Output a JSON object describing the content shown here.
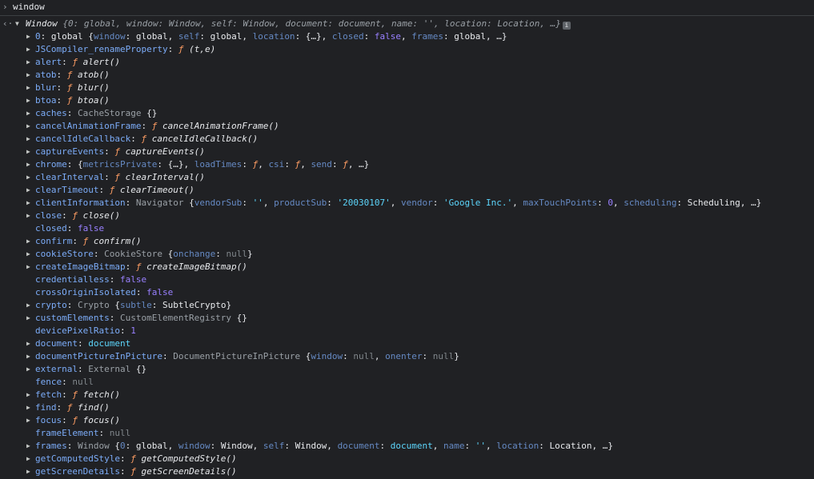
{
  "input": {
    "prompt": "›",
    "command": "window"
  },
  "result_marker": "‹·",
  "root": {
    "label": "Window",
    "preview": "{0: global, window: Window, self: Window, document: document, name: '', location: Location, …}",
    "info_glyph": "i"
  },
  "props": [
    {
      "key": "0",
      "expandable": true,
      "parts": [
        [
          "obj",
          "global "
        ],
        [
          "p",
          "{"
        ],
        [
          "kd",
          "window"
        ],
        [
          "p",
          ": global, "
        ],
        [
          "kd",
          "self"
        ],
        [
          "p",
          ": global, "
        ],
        [
          "kd",
          "location"
        ],
        [
          "p",
          ": {…}, "
        ],
        [
          "kd",
          "closed"
        ],
        [
          "p",
          ": "
        ],
        [
          "b",
          "false"
        ],
        [
          "p",
          ", "
        ],
        [
          "kd",
          "frames"
        ],
        [
          "p",
          ": global, …}"
        ]
      ]
    },
    {
      "key": "JSCompiler_renameProperty",
      "expandable": true,
      "parts": [
        [
          "fn",
          "ƒ "
        ],
        [
          "fname",
          "(t,e)"
        ]
      ]
    },
    {
      "key": "alert",
      "expandable": true,
      "parts": [
        [
          "fn",
          "ƒ "
        ],
        [
          "fname",
          "alert()"
        ]
      ]
    },
    {
      "key": "atob",
      "expandable": true,
      "parts": [
        [
          "fn",
          "ƒ "
        ],
        [
          "fname",
          "atob()"
        ]
      ]
    },
    {
      "key": "blur",
      "expandable": true,
      "parts": [
        [
          "fn",
          "ƒ "
        ],
        [
          "fname",
          "blur()"
        ]
      ]
    },
    {
      "key": "btoa",
      "expandable": true,
      "parts": [
        [
          "fn",
          "ƒ "
        ],
        [
          "fname",
          "btoa()"
        ]
      ]
    },
    {
      "key": "caches",
      "expandable": true,
      "parts": [
        [
          "cls",
          "CacheStorage "
        ],
        [
          "p",
          "{}"
        ]
      ]
    },
    {
      "key": "cancelAnimationFrame",
      "expandable": true,
      "parts": [
        [
          "fn",
          "ƒ "
        ],
        [
          "fname",
          "cancelAnimationFrame()"
        ]
      ]
    },
    {
      "key": "cancelIdleCallback",
      "expandable": true,
      "parts": [
        [
          "fn",
          "ƒ "
        ],
        [
          "fname",
          "cancelIdleCallback()"
        ]
      ]
    },
    {
      "key": "captureEvents",
      "expandable": true,
      "parts": [
        [
          "fn",
          "ƒ "
        ],
        [
          "fname",
          "captureEvents()"
        ]
      ]
    },
    {
      "key": "chrome",
      "expandable": true,
      "parts": [
        [
          "p",
          "{"
        ],
        [
          "kd",
          "metricsPrivate"
        ],
        [
          "p",
          ": {…}, "
        ],
        [
          "kd",
          "loadTimes"
        ],
        [
          "p",
          ": "
        ],
        [
          "fn",
          "ƒ"
        ],
        [
          "p",
          ", "
        ],
        [
          "kd",
          "csi"
        ],
        [
          "p",
          ": "
        ],
        [
          "fn",
          "ƒ"
        ],
        [
          "p",
          ", "
        ],
        [
          "kd",
          "send"
        ],
        [
          "p",
          ": "
        ],
        [
          "fn",
          "ƒ"
        ],
        [
          "p",
          ", …}"
        ]
      ]
    },
    {
      "key": "clearInterval",
      "expandable": true,
      "parts": [
        [
          "fn",
          "ƒ "
        ],
        [
          "fname",
          "clearInterval()"
        ]
      ]
    },
    {
      "key": "clearTimeout",
      "expandable": true,
      "parts": [
        [
          "fn",
          "ƒ "
        ],
        [
          "fname",
          "clearTimeout()"
        ]
      ]
    },
    {
      "key": "clientInformation",
      "expandable": true,
      "parts": [
        [
          "cls",
          "Navigator "
        ],
        [
          "p",
          "{"
        ],
        [
          "kd",
          "vendorSub"
        ],
        [
          "p",
          ": "
        ],
        [
          "s",
          "''"
        ],
        [
          "p",
          ", "
        ],
        [
          "kd",
          "productSub"
        ],
        [
          "p",
          ": "
        ],
        [
          "s",
          "'20030107'"
        ],
        [
          "p",
          ", "
        ],
        [
          "kd",
          "vendor"
        ],
        [
          "p",
          ": "
        ],
        [
          "s",
          "'Google Inc.'"
        ],
        [
          "p",
          ", "
        ],
        [
          "kd",
          "maxTouchPoints"
        ],
        [
          "p",
          ": "
        ],
        [
          "b",
          "0"
        ],
        [
          "p",
          ", "
        ],
        [
          "kd",
          "scheduling"
        ],
        [
          "p",
          ": Scheduling, …}"
        ]
      ]
    },
    {
      "key": "close",
      "expandable": true,
      "parts": [
        [
          "fn",
          "ƒ "
        ],
        [
          "fname",
          "close()"
        ]
      ]
    },
    {
      "key": "closed",
      "expandable": false,
      "parts": [
        [
          "b",
          "false"
        ]
      ]
    },
    {
      "key": "confirm",
      "expandable": true,
      "parts": [
        [
          "fn",
          "ƒ "
        ],
        [
          "fname",
          "confirm()"
        ]
      ]
    },
    {
      "key": "cookieStore",
      "expandable": true,
      "parts": [
        [
          "cls",
          "CookieStore "
        ],
        [
          "p",
          "{"
        ],
        [
          "kd",
          "onchange"
        ],
        [
          "p",
          ": "
        ],
        [
          "n",
          "null"
        ],
        [
          "p",
          "}"
        ]
      ]
    },
    {
      "key": "createImageBitmap",
      "expandable": true,
      "parts": [
        [
          "fn",
          "ƒ "
        ],
        [
          "fname",
          "createImageBitmap()"
        ]
      ]
    },
    {
      "key": "credentialless",
      "expandable": false,
      "parts": [
        [
          "b",
          "false"
        ]
      ]
    },
    {
      "key": "crossOriginIsolated",
      "expandable": false,
      "parts": [
        [
          "b",
          "false"
        ]
      ]
    },
    {
      "key": "crypto",
      "expandable": true,
      "parts": [
        [
          "cls",
          "Crypto "
        ],
        [
          "p",
          "{"
        ],
        [
          "kd",
          "subtle"
        ],
        [
          "p",
          ": SubtleCrypto}"
        ]
      ]
    },
    {
      "key": "customElements",
      "expandable": true,
      "parts": [
        [
          "cls",
          "CustomElementRegistry "
        ],
        [
          "p",
          "{}"
        ]
      ]
    },
    {
      "key": "devicePixelRatio",
      "expandable": false,
      "parts": [
        [
          "b",
          "1"
        ]
      ]
    },
    {
      "key": "document",
      "expandable": true,
      "parts": [
        [
          "s",
          "document"
        ]
      ]
    },
    {
      "key": "documentPictureInPicture",
      "expandable": true,
      "parts": [
        [
          "cls",
          "DocumentPictureInPicture "
        ],
        [
          "p",
          "{"
        ],
        [
          "kd",
          "window"
        ],
        [
          "p",
          ": "
        ],
        [
          "n",
          "null"
        ],
        [
          "p",
          ", "
        ],
        [
          "kd",
          "onenter"
        ],
        [
          "p",
          ": "
        ],
        [
          "n",
          "null"
        ],
        [
          "p",
          "}"
        ]
      ]
    },
    {
      "key": "external",
      "expandable": true,
      "parts": [
        [
          "cls",
          "External "
        ],
        [
          "p",
          "{}"
        ]
      ]
    },
    {
      "key": "fence",
      "expandable": false,
      "parts": [
        [
          "n",
          "null"
        ]
      ]
    },
    {
      "key": "fetch",
      "expandable": true,
      "parts": [
        [
          "fn",
          "ƒ "
        ],
        [
          "fname",
          "fetch()"
        ]
      ]
    },
    {
      "key": "find",
      "expandable": true,
      "parts": [
        [
          "fn",
          "ƒ "
        ],
        [
          "fname",
          "find()"
        ]
      ]
    },
    {
      "key": "focus",
      "expandable": true,
      "parts": [
        [
          "fn",
          "ƒ "
        ],
        [
          "fname",
          "focus()"
        ]
      ]
    },
    {
      "key": "frameElement",
      "expandable": false,
      "parts": [
        [
          "n",
          "null"
        ]
      ]
    },
    {
      "key": "frames",
      "expandable": true,
      "parts": [
        [
          "cls",
          "Window "
        ],
        [
          "p",
          "{"
        ],
        [
          "kd",
          "0"
        ],
        [
          "p",
          ": global, "
        ],
        [
          "kd",
          "window"
        ],
        [
          "p",
          ": Window, "
        ],
        [
          "kd",
          "self"
        ],
        [
          "p",
          ": Window, "
        ],
        [
          "kd",
          "document"
        ],
        [
          "p",
          ": "
        ],
        [
          "s",
          "document"
        ],
        [
          "p",
          ", "
        ],
        [
          "kd",
          "name"
        ],
        [
          "p",
          ": "
        ],
        [
          "s",
          "''"
        ],
        [
          "p",
          ", "
        ],
        [
          "kd",
          "location"
        ],
        [
          "p",
          ": Location, …}"
        ]
      ]
    },
    {
      "key": "getComputedStyle",
      "expandable": true,
      "parts": [
        [
          "fn",
          "ƒ "
        ],
        [
          "fname",
          "getComputedStyle()"
        ]
      ]
    },
    {
      "key": "getScreenDetails",
      "expandable": true,
      "parts": [
        [
          "fn",
          "ƒ "
        ],
        [
          "fname",
          "getScreenDetails()"
        ]
      ]
    }
  ],
  "colors": {
    "background": "#202124",
    "key": "#7cacf8",
    "function_marker": "#ff9e64",
    "boolean_number": "#9980ff",
    "string": "#5cd5fb",
    "null": "#80868b"
  }
}
